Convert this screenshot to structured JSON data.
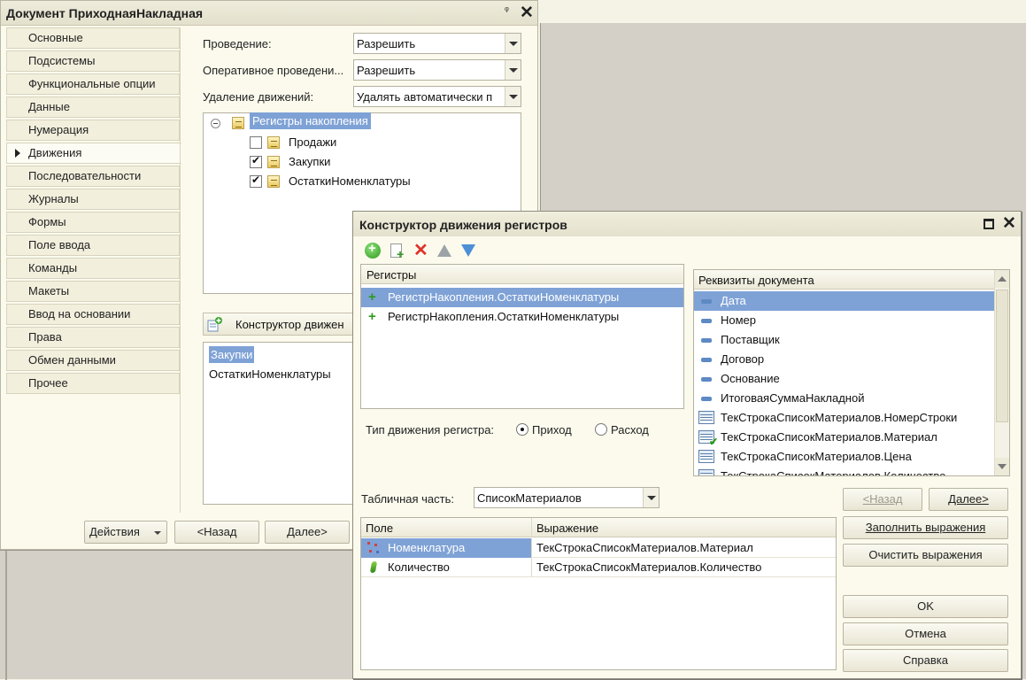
{
  "doc_window": {
    "title": "Документ ПриходнаяНакладная",
    "nav": [
      {
        "label": "Основные"
      },
      {
        "label": "Подсистемы"
      },
      {
        "label": "Функциональные опции"
      },
      {
        "label": "Данные"
      },
      {
        "label": "Нумерация"
      },
      {
        "label": "Движения"
      },
      {
        "label": "Последовательности"
      },
      {
        "label": "Журналы"
      },
      {
        "label": "Формы"
      },
      {
        "label": "Поле ввода"
      },
      {
        "label": "Команды"
      },
      {
        "label": "Макеты"
      },
      {
        "label": "Ввод на основании"
      },
      {
        "label": "Права"
      },
      {
        "label": "Обмен данными"
      },
      {
        "label": "Прочее"
      }
    ],
    "active_nav": "Движения",
    "posting_label": "Проведение:",
    "posting_value": "Разрешить",
    "online_posting_label": "Оперативное проведени...",
    "online_posting_value": "Разрешить",
    "delete_moves_label": "Удаление движений:",
    "delete_moves_value": "Удалять автоматически п",
    "tree": {
      "root": "Регистры накопления",
      "children": [
        {
          "label": "Продажи",
          "checked": false
        },
        {
          "label": "Закупки",
          "checked": true
        },
        {
          "label": "ОстаткиНоменклатуры",
          "checked": true
        }
      ]
    },
    "constructor_button": "Конструктор движен",
    "moves_list": [
      "Закупки",
      "ОстаткиНоменклатуры"
    ],
    "actions_button": "Действия",
    "back_button": "<Назад",
    "next_button": "Далее>"
  },
  "constructor_window": {
    "title": "Конструктор движения регистров",
    "toolbar_icons": [
      "add-icon",
      "copy-icon",
      "delete-icon",
      "move-up-icon",
      "move-down-icon"
    ],
    "registers_header": "Регистры",
    "registers": [
      "РегистрНакопления.ОстаткиНоменклатуры",
      "РегистрНакопления.ОстаткиНоменклатуры"
    ],
    "doc_attrs_header": "Реквизиты документа",
    "doc_attrs": [
      {
        "label": "Дата",
        "kind": "attribute"
      },
      {
        "label": "Номер",
        "kind": "attribute"
      },
      {
        "label": "Поставщик",
        "kind": "attribute"
      },
      {
        "label": "Договор",
        "kind": "attribute"
      },
      {
        "label": "Основание",
        "kind": "attribute"
      },
      {
        "label": "ИтоговаяСуммаНакладной",
        "kind": "attribute"
      },
      {
        "label": "ТекСтрокаСписокМатериалов.НомерСтроки",
        "kind": "table"
      },
      {
        "label": "ТекСтрокаСписокМатериалов.Материал",
        "kind": "table-checked"
      },
      {
        "label": "ТекСтрокаСписокМатериалов.Цена",
        "kind": "table"
      },
      {
        "label": "ТекСтрокаСписокМатериалов.Количество",
        "kind": "table"
      }
    ],
    "move_type_label": "Тип движения регистра:",
    "move_type_options": [
      "Приход",
      "Расход"
    ],
    "move_type_selected": "Приход",
    "table_part_label": "Табличная часть:",
    "table_part_value": "СписокМатериалов",
    "back_button": "<Назад",
    "next_button": "Далее>",
    "grid_headers": {
      "field": "Поле",
      "expression": "Выражение"
    },
    "grid_rows": [
      {
        "field": "Номенклатура",
        "expression": "ТекСтрокаСписокМатериалов.Материал"
      },
      {
        "field": "Количество",
        "expression": "ТекСтрокаСписокМатериалов.Количество"
      }
    ],
    "fill_button": "Заполнить выражения",
    "clear_button": "Очистить выражения",
    "ok_button": "OK",
    "cancel_button": "Отмена",
    "help_button": "Справка",
    "colors": {
      "selection": "#7fa2d6",
      "window_bg": "#fbfaed"
    }
  }
}
